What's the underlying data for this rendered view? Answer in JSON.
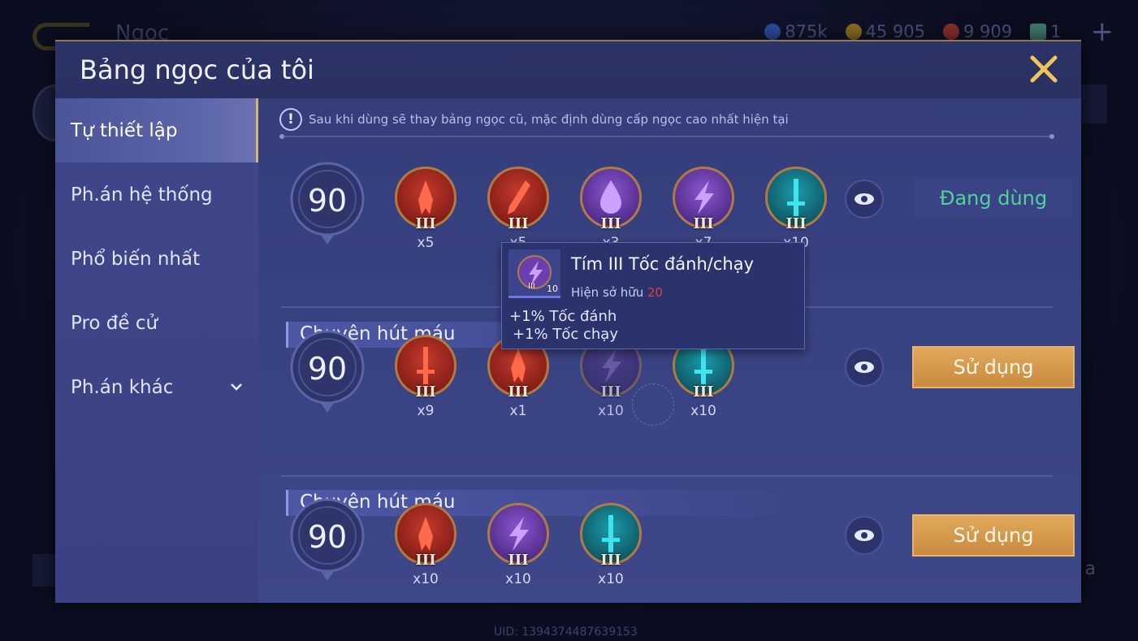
{
  "background": {
    "title": "Ngọc",
    "currencies": [
      {
        "icon": "gem-currency-icon",
        "value": "875k",
        "color": "#3c6ad6"
      },
      {
        "icon": "gold-coin-icon",
        "value": "45 905",
        "color": "#c9a031"
      },
      {
        "icon": "red-gem-icon",
        "value": "9 909",
        "color": "#c0423a"
      },
      {
        "icon": "card-icon",
        "value": "1",
        "color": "#5fb7a0"
      }
    ],
    "right_text": "a",
    "uid": "UID: 1394374487639153"
  },
  "modal": {
    "title": "Bảng ngọc của tôi",
    "notice": "Sau khi dùng sẽ thay bảng ngọc cũ, mặc định dùng cấp ngọc cao nhất hiện tại"
  },
  "sidebar": {
    "items": [
      {
        "label": "Tự thiết lập",
        "active": true
      },
      {
        "label": "Ph.án hệ thống",
        "active": false
      },
      {
        "label": "Phổ biến nhất",
        "active": false
      },
      {
        "label": "Pro đề cử",
        "active": false
      },
      {
        "label": "Ph.án khác",
        "active": false,
        "expandable": true
      }
    ]
  },
  "pages": [
    {
      "level": "90",
      "name": "",
      "status": "Đang dùng",
      "gems": [
        {
          "color": "red",
          "shape": "flame",
          "tier": "III",
          "count": "x5"
        },
        {
          "color": "red",
          "shape": "blade",
          "tier": "III",
          "count": "x5"
        },
        {
          "color": "purple",
          "shape": "drop",
          "tier": "III",
          "count": "x3"
        },
        {
          "color": "purple",
          "shape": "bolt",
          "tier": "III",
          "count": "x7"
        },
        {
          "color": "teal",
          "shape": "sword",
          "tier": "III",
          "count": "x10"
        }
      ]
    },
    {
      "level": "90",
      "name": "Chuyên hút máu",
      "button": "Sử dụng",
      "gems": [
        {
          "color": "red",
          "shape": "sword",
          "tier": "III",
          "count": "x9"
        },
        {
          "color": "red",
          "shape": "flame",
          "tier": "III",
          "count": "x1"
        },
        {
          "color": "purple",
          "shape": "bolt",
          "tier": "III",
          "count": "x10"
        },
        {
          "color": "teal",
          "shape": "sword",
          "tier": "III",
          "count": "x10"
        }
      ]
    },
    {
      "level": "90",
      "name": "Chuyên hút máu",
      "button": "Sử dụng",
      "gems": [
        {
          "color": "red",
          "shape": "flame",
          "tier": "III",
          "count": "x10"
        },
        {
          "color": "purple",
          "shape": "bolt",
          "tier": "III",
          "count": "x10"
        },
        {
          "color": "teal",
          "shape": "sword",
          "tier": "III",
          "count": "x10"
        }
      ]
    }
  ],
  "tooltip": {
    "title": "Tím III Tốc đánh/chạy",
    "owned_label": "Hiện sở hữu",
    "owned_value": "20",
    "icon_tier": "III",
    "icon_count": "10",
    "stats": [
      "+1% Tốc đánh",
      "+1% Tốc chạy"
    ]
  },
  "colors": {
    "red": "#a9271f",
    "purple": "#6d3fae",
    "teal": "#127f8d",
    "accent_gold": "#d8b46e",
    "active_green": "#4fd39a"
  }
}
